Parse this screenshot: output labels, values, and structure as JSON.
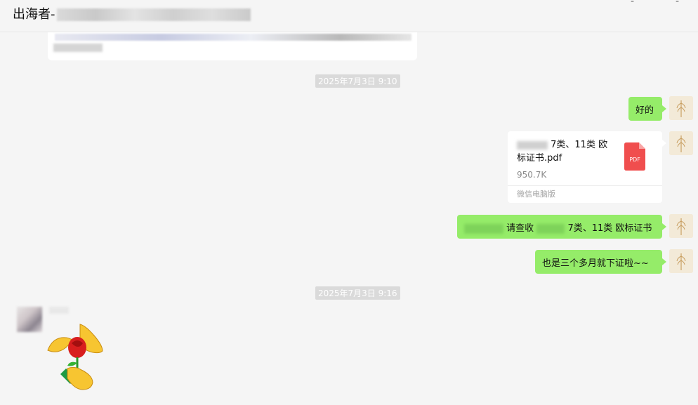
{
  "header": {
    "title": "出海者-"
  },
  "window": {
    "min_glyph": "-",
    "close_glyph": "-"
  },
  "timestamps": [
    "2025年7月3日 9:10",
    "2025年7月3日 9:16"
  ],
  "messages": {
    "ok": "好的",
    "file": {
      "name_part1": "7类、11类 欧",
      "name_part2": "标证书.pdf",
      "size": "950.7K",
      "source": "微信电脑版",
      "icon_label": "PDF",
      "icon_color": "#f04e4e"
    },
    "receive_a": "请查收",
    "receive_b": "7类、11类 欧标证书",
    "three_months": "也是三个多月就下证啦~~"
  },
  "colors": {
    "bubble_green": "#95ec69",
    "background": "#f5f5f5",
    "timestamp_bg": "#dadada"
  },
  "icons": [
    "wheat-avatar-icon",
    "pdf-file-icon",
    "rose-handshake-sticker"
  ]
}
